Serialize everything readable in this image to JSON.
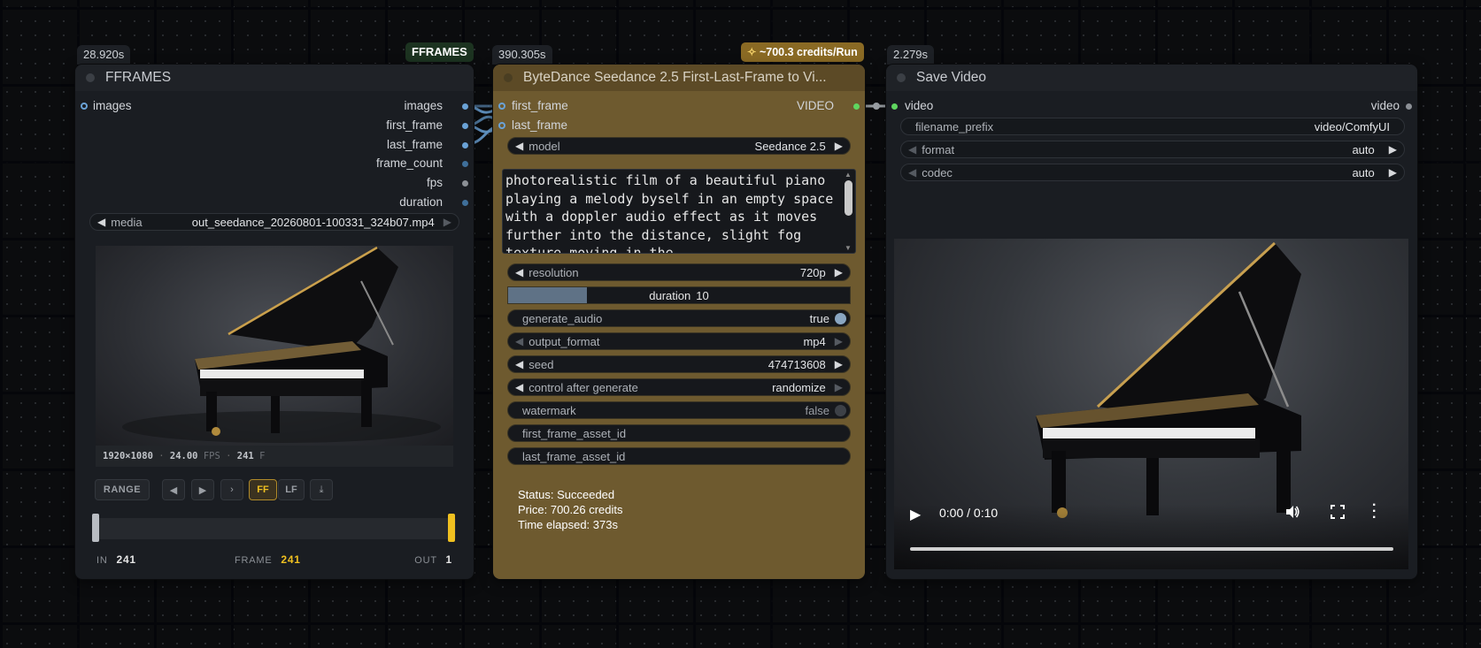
{
  "fframes": {
    "time_badge": "28.920s",
    "type_badge": "FFRAMES",
    "title": "FFRAMES",
    "input_slot": "images",
    "outputs": [
      "images",
      "first_frame",
      "last_frame",
      "frame_count",
      "fps",
      "duration"
    ],
    "media_label": "media",
    "media_value": "out_seedance_20260801-100331_324b07.mp4",
    "info": {
      "resolution": "1920×1080",
      "fps_value": "24.00",
      "fps_unit": "FPS",
      "frames_value": "241",
      "frames_unit": "F",
      "sep": "·"
    },
    "buttons": {
      "range": "RANGE",
      "ff": "FF",
      "lf": "LF"
    },
    "in_label": "IN",
    "in_value": "241",
    "frame_label": "FRAME",
    "frame_value": "241",
    "out_label": "OUT",
    "out_value": "1"
  },
  "seedance": {
    "time_badge": "390.305s",
    "credits_badge": "~700.3 credits/Run",
    "title": "ByteDance Seedance 2.5 First-Last-Frame to Vi...",
    "inputs": [
      "first_frame",
      "last_frame"
    ],
    "output": "VIDEO",
    "model": {
      "label": "model",
      "value": "Seedance 2.5"
    },
    "prompt": "photorealistic film of a beautiful piano playing a melody byself in an empty space with a doppler audio effect as it moves further into the distance, slight fog texture moving in the",
    "resolution": {
      "label": "resolution",
      "value": "720p"
    },
    "duration": {
      "label": "duration",
      "value": "10",
      "fill": 0.23
    },
    "generate_audio": {
      "label": "generate_audio",
      "value": "true"
    },
    "output_format": {
      "label": "output_format",
      "value": "mp4"
    },
    "seed": {
      "label": "seed",
      "value": "474713608"
    },
    "control": {
      "label": "control after generate",
      "value": "randomize"
    },
    "watermark": {
      "label": "watermark",
      "value": "false"
    },
    "first_frame_asset_id": "first_frame_asset_id",
    "last_frame_asset_id": "last_frame_asset_id",
    "status": "Status: Succeeded",
    "price": "Price: 700.26 credits",
    "elapsed": "Time elapsed: 373s"
  },
  "save_video": {
    "time_badge": "2.279s",
    "title": "Save Video",
    "input": "video",
    "output": "video",
    "filename_prefix": {
      "label": "filename_prefix",
      "value": "video/ComfyUI"
    },
    "format": {
      "label": "format",
      "value": "auto"
    },
    "codec": {
      "label": "codec",
      "value": "auto"
    },
    "player": {
      "time": "0:00 / 0:10",
      "progress": 0
    }
  },
  "icons": [
    "play-icon",
    "volume-icon",
    "fullscreen-icon",
    "more-icon",
    "download-icon",
    "prev-icon",
    "next-icon",
    "step-icon",
    "credits-icon"
  ],
  "colors": {
    "accent_gold": "#f0c020",
    "node_gold": "#6e5a2f",
    "link_blue": "#6aa2d6",
    "port_green": "#5fd65f"
  }
}
